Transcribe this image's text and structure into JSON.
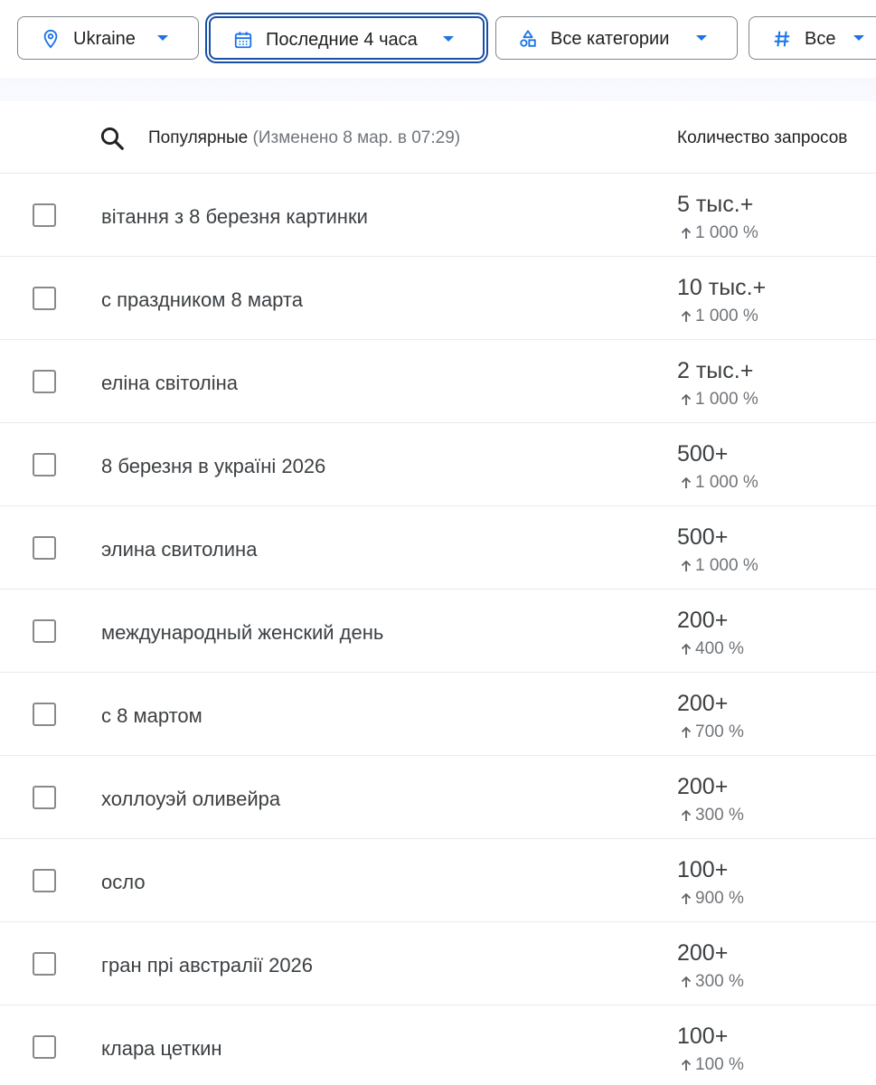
{
  "filters": {
    "geo": {
      "label": "Ukraine",
      "icon": "location-pin-icon"
    },
    "time": {
      "label": "Последние 4 часа",
      "icon": "calendar-icon",
      "active": true
    },
    "category": {
      "label": "Все категории",
      "icon": "category-shapes-icon"
    },
    "type": {
      "label": "Все",
      "icon": "hashtag-icon"
    }
  },
  "table": {
    "title": "Популярные",
    "updated": "(Изменено 8 мар. в 07:29)",
    "volume_header": "Количество запросов",
    "rows": [
      {
        "term": "вітання з 8 березня картинки",
        "volume": "5 тыс.+",
        "growth": "1 000 %"
      },
      {
        "term": "с праздником 8 марта",
        "volume": "10 тыс.+",
        "growth": "1 000 %"
      },
      {
        "term": "еліна світоліна",
        "volume": "2 тыс.+",
        "growth": "1 000 %"
      },
      {
        "term": "8 березня в україні 2026",
        "volume": "500+",
        "growth": "1 000 %"
      },
      {
        "term": "элина свитолина",
        "volume": "500+",
        "growth": "1 000 %"
      },
      {
        "term": "международный женский день",
        "volume": "200+",
        "growth": "400 %"
      },
      {
        "term": "с 8 мартом",
        "volume": "200+",
        "growth": "700 %"
      },
      {
        "term": "холлоуэй оливейра",
        "volume": "200+",
        "growth": "300 %"
      },
      {
        "term": "осло",
        "volume": "100+",
        "growth": "900 %"
      },
      {
        "term": "гран прі австралії 2026",
        "volume": "200+",
        "growth": "300 %"
      },
      {
        "term": "клара цеткин",
        "volume": "100+",
        "growth": "100 %"
      }
    ]
  },
  "colors": {
    "accent": "#1a73e8",
    "focus_ring": "#174ea6",
    "text_primary": "#202124",
    "text_secondary": "#70757a"
  }
}
